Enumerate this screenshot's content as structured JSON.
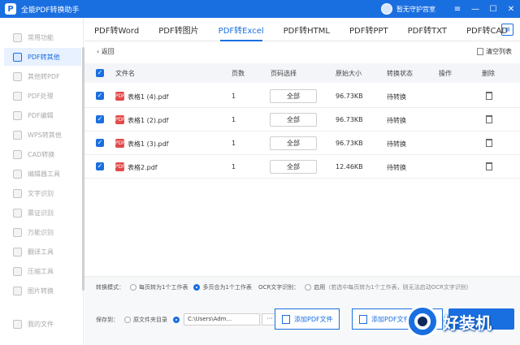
{
  "window": {
    "title": "全能PDF转换助手",
    "user_name": "暂无守护宫室",
    "controls": [
      "≡",
      "—",
      "☐",
      "✕"
    ]
  },
  "sidebar": {
    "items": [
      {
        "label": "常用功能",
        "icon": "grid-icon"
      },
      {
        "label": "PDF转其他",
        "icon": "pdf-convert-icon",
        "active": true
      },
      {
        "label": "其他转PDF",
        "icon": "to-pdf-icon"
      },
      {
        "label": "PDF处理",
        "icon": "pdf-process-icon"
      },
      {
        "label": "PDF编辑",
        "icon": "pdf-edit-icon"
      },
      {
        "label": "WPS转其他",
        "icon": "wps-icon"
      },
      {
        "label": "CAD转换",
        "icon": "cad-icon"
      },
      {
        "label": "编辑器工具",
        "icon": "editor-icon"
      },
      {
        "label": "文字识别",
        "icon": "ocr-icon"
      },
      {
        "label": "票证识别",
        "icon": "ticket-icon"
      },
      {
        "label": "万能识别",
        "icon": "scan-icon"
      },
      {
        "label": "翻译工具",
        "icon": "translate-icon"
      },
      {
        "label": "压缩工具",
        "icon": "compress-icon"
      },
      {
        "label": "图片转换",
        "icon": "image-icon"
      },
      {
        "label": "我的文件",
        "icon": "folder-icon"
      }
    ]
  },
  "tabs": [
    {
      "label": "PDF转Word"
    },
    {
      "label": "PDF转图片"
    },
    {
      "label": "PDF转Excel",
      "active": true
    },
    {
      "label": "PDF转HTML"
    },
    {
      "label": "PDF转PPT"
    },
    {
      "label": "PDF转TXT"
    },
    {
      "label": "PDF转CAD"
    }
  ],
  "toolbar": {
    "back_label": "返回",
    "clear_label": "清空列表"
  },
  "table": {
    "headers": {
      "filename": "文件名",
      "pages": "页数",
      "page_select": "页码选择",
      "size": "原始大小",
      "status": "转换状态",
      "action": "操作",
      "delete": "删除"
    },
    "rows": [
      {
        "filename": "表格1 (4).pdf",
        "pages": "1",
        "page_select": "全部",
        "size": "96.73KB",
        "status": "待转换"
      },
      {
        "filename": "表格1 (2).pdf",
        "pages": "1",
        "page_select": "全部",
        "size": "96.73KB",
        "status": "待转换"
      },
      {
        "filename": "表格1 (3).pdf",
        "pages": "1",
        "page_select": "全部",
        "size": "96.73KB",
        "status": "待转换"
      },
      {
        "filename": "表格2.pdf",
        "pages": "1",
        "page_select": "全部",
        "size": "12.46KB",
        "status": "待转换"
      }
    ]
  },
  "options": {
    "mode_label": "转换模式：",
    "mode_option1": "每页转为1个工作表",
    "mode_option2": "多页合为1个工作表",
    "ocr_label": "OCR文字识别：",
    "ocr_option": "启用",
    "ocr_hint": "（若选中每页转为1个工作表，则无法启动OCR文字识别）"
  },
  "save": {
    "label": "保存到：",
    "option_source": "原文件夹目录",
    "path": "C:\\Users\\Adm...",
    "browse": "···"
  },
  "buttons": {
    "add_pdf": "添加PDF文件",
    "add_pdf_folder": "添加PDF文件夹"
  },
  "watermark": {
    "text": "好装机"
  },
  "colors": {
    "brand": "#1a6fe0",
    "pdf_icon": "#e24a4a"
  }
}
